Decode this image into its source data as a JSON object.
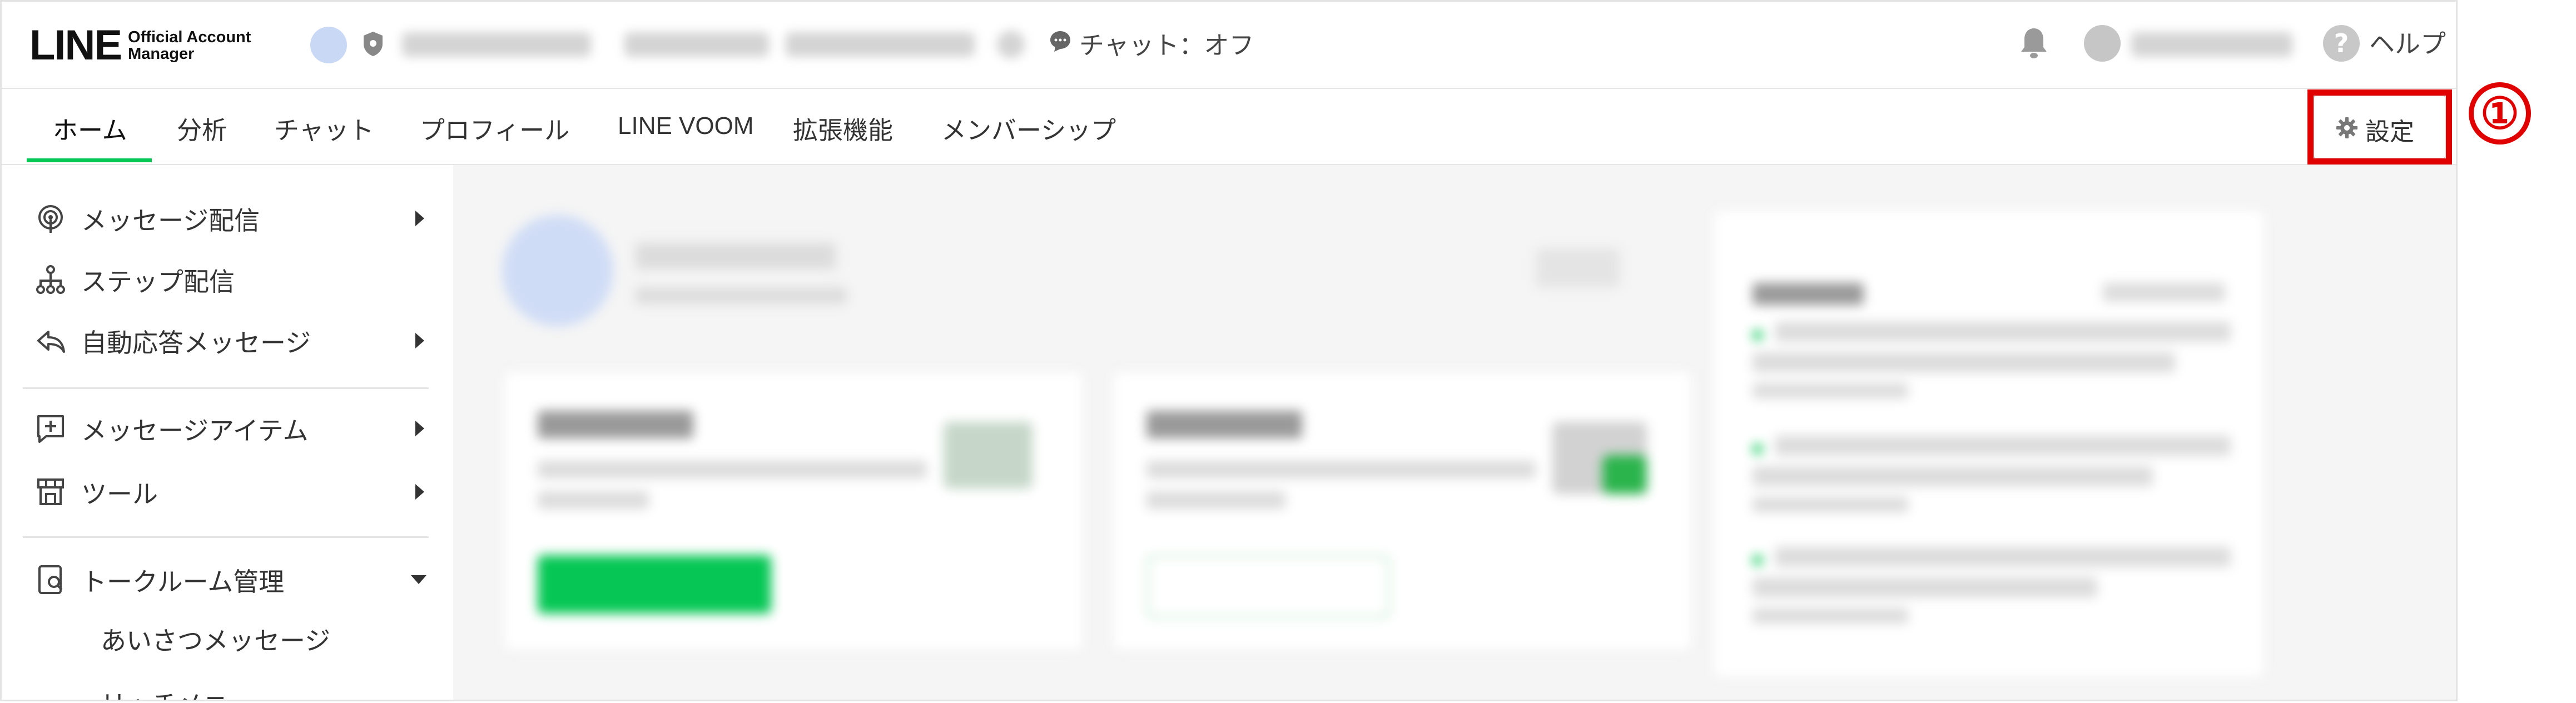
{
  "header": {
    "logo_main": "LINE",
    "logo_sub_1": "Official Account",
    "logo_sub_2": "Manager",
    "chat_status": "チャット：オフ",
    "help_label": "ヘルプ"
  },
  "nav": {
    "tabs": [
      {
        "label": "ホーム",
        "active": true
      },
      {
        "label": "分析",
        "active": false
      },
      {
        "label": "チャット",
        "active": false
      },
      {
        "label": "プロフィール",
        "active": false
      },
      {
        "label": "LINE VOOM",
        "active": false
      },
      {
        "label": "拡張機能",
        "active": false
      },
      {
        "label": "メンバーシップ",
        "active": false
      }
    ],
    "settings_label": "設定"
  },
  "annotation": {
    "marker": "①"
  },
  "sidebar": {
    "items": [
      {
        "label": "メッセージ配信",
        "icon": "broadcast-icon"
      },
      {
        "label": "ステップ配信",
        "icon": "step-flow-icon"
      },
      {
        "label": "自動応答メッセージ",
        "icon": "auto-reply-icon"
      },
      {
        "label": "メッセージアイテム",
        "icon": "message-item-icon"
      },
      {
        "label": "ツール",
        "icon": "tools-icon"
      },
      {
        "label": "トークルーム管理",
        "icon": "talkroom-icon"
      }
    ],
    "sub_items": [
      "あいさつメッセージ",
      "リッチメニュー"
    ]
  },
  "colors": {
    "accent": "#06c755",
    "annotation": "#e00000"
  }
}
